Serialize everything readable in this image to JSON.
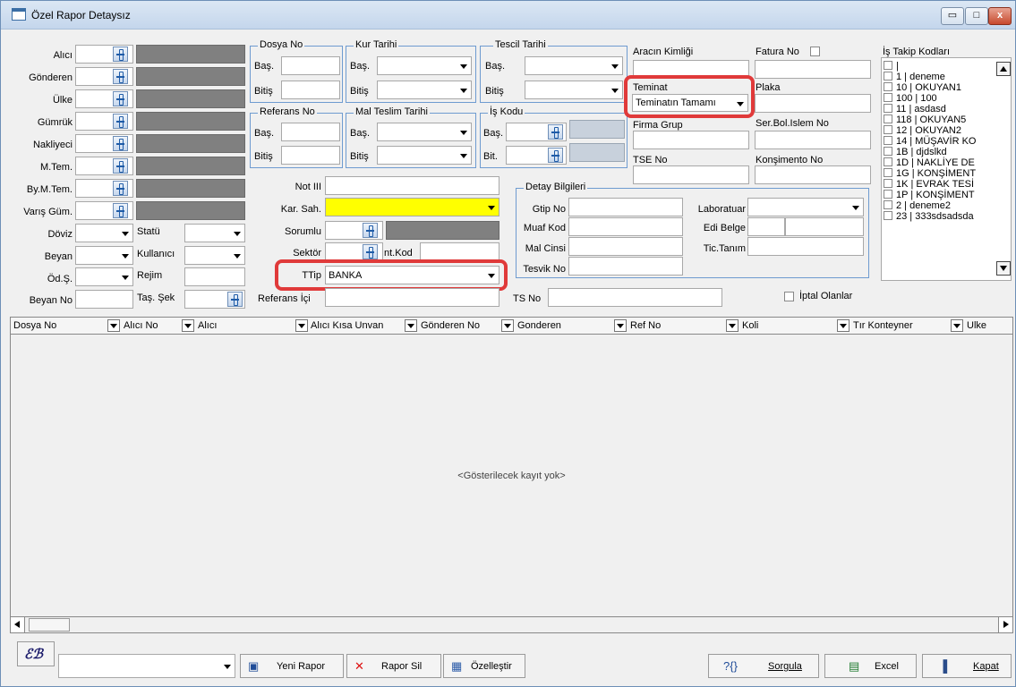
{
  "window": {
    "title": "Özel Rapor Detaysız",
    "min_label": "▭",
    "max_label": "□",
    "close_label": "x"
  },
  "left": {
    "alici": "Alıcı",
    "gonderen": "Gönderen",
    "ulke": "Ülke",
    "gumruk": "Gümrük",
    "nakliyeci": "Nakliyeci",
    "mtem": "M.Tem.",
    "bymtem": "By.M.Tem.",
    "varis": "Varış Güm.",
    "doviz": "Döviz",
    "statu": "Statü",
    "beyan": "Beyan",
    "kullanici": "Kullanıcı",
    "ods": "Öd.Ş.",
    "rejim": "Rejim",
    "beyanno": "Beyan No",
    "tassek": "Taş. Şek"
  },
  "groups": {
    "dosya_no": "Dosya No",
    "kur_tarihi": "Kur Tarihi",
    "tescil_tarihi": "Tescil Tarihi",
    "referans_no": "Referans No",
    "mal_teslim": "Mal Teslim Tarihi",
    "is_kodu": "İş Kodu",
    "detay": "Detay Bilgileri",
    "bas": "Baş.",
    "bitis": "Bitiş",
    "bit": "Bit."
  },
  "mid": {
    "not3": "Not III",
    "karsah": "Kar. Sah.",
    "sorumlu": "Sorumlu",
    "sektor": "Sektör",
    "intkod": "nt.Kod",
    "ttip": "TTip",
    "ttip_value": "BANKA",
    "refic": "Referans İçi"
  },
  "right": {
    "aracin": "Aracın Kimliği",
    "fatura": "Fatura No",
    "teminat": "Teminat",
    "teminat_value": "Teminatın Tamamı",
    "plaka": "Plaka",
    "firma": "Firma Grup",
    "serbol": "Ser.Bol.Islem No",
    "tse": "TSE No",
    "konsimento": "Konşimento No",
    "istakip": "İş Takip Kodları"
  },
  "detay": {
    "gtip": "Gtip No",
    "muaf": "Muaf Kod",
    "malcinsi": "Mal Cinsi",
    "tesvik": "Tesvik No",
    "lab": "Laboratuar",
    "edi": "Edi Belge",
    "tic": "Tic.Tanım",
    "tsno": "TS No",
    "iptal": "İptal Olanlar"
  },
  "istakip_items": [
    "|",
    "1 | deneme",
    "10 | OKUYAN1",
    "100 | 100",
    "11 | asdasd",
    "118 | OKUYAN5",
    "12 | OKUYAN2",
    "14 | MÜŞAVİR KO",
    "1B | djdslkd",
    "1D | NAKLİYE DE",
    "1G | KONŞİMENT",
    "1K | EVRAK TESİ",
    "1P | KONŞİMENT",
    "2 | deneme2",
    "23 | 333sdsadsda"
  ],
  "grid": {
    "columns": [
      "Dosya No",
      "Alıcı No",
      "Alıcı",
      "Alıcı Kısa Unvan",
      "Gönderen No",
      "Gonderen",
      "Ref No",
      "Koli",
      "Tır Konteyner",
      "Ulke"
    ],
    "empty": "<Gösterilecek kayıt yok>"
  },
  "footer": {
    "yeni": "Yeni Rapor",
    "sil": "Rapor Sil",
    "ozel": "Özelleştir",
    "sorgula": "Sorgula",
    "excel": "Excel",
    "kapat": "Kapat"
  },
  "colors": {
    "highlight_field": "#ffff00",
    "annotation_red": "#e03a3a",
    "group_border": "#6e9bd0"
  }
}
